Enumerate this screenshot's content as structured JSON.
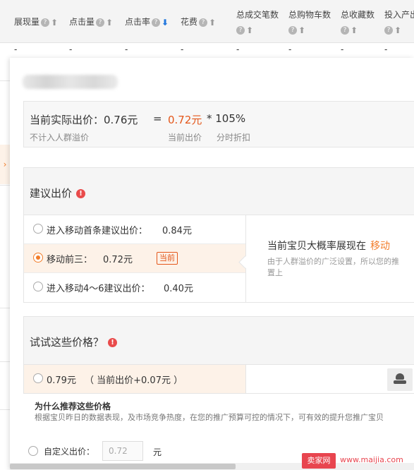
{
  "table_header": {
    "columns": [
      {
        "label": "展现量",
        "sort": "none"
      },
      {
        "label": "点击量",
        "sort": "none"
      },
      {
        "label": "点击率",
        "sort": "desc"
      },
      {
        "label": "花费",
        "sort": "none"
      },
      {
        "label": "总成交笔数",
        "sort": "none"
      },
      {
        "label": "总购物车数",
        "sort": "none"
      },
      {
        "label": "总收藏数",
        "sort": "none"
      },
      {
        "label": "投入产出",
        "sort": "none"
      }
    ],
    "row_dash": "-"
  },
  "bid_summary": {
    "actual_label": "当前实际出价：0.76元",
    "equals": "=",
    "current_bid": "0.72元",
    "multiplier": "* 105%",
    "note_actual": "不计入人群溢价",
    "note_current": "当前出价",
    "note_discount": "分时折扣"
  },
  "suggest": {
    "title": "建议出价",
    "options": [
      {
        "label": "进入移动首条建议出价：",
        "value": "0.84元",
        "selected": false
      },
      {
        "label": "移动前三：",
        "value": "0.72元",
        "selected": true,
        "badge": "当前"
      },
      {
        "label": "进入移动4～6建议出价：",
        "value": "0.40元",
        "selected": false
      }
    ],
    "right_title": "当前宝贝大概率展现在",
    "right_highlight": "移动",
    "right_desc_line1": "由于人群溢价的广泛设置，所以您的推",
    "right_desc_line2": "置上"
  },
  "try_prices": {
    "title": "试试这些价格？",
    "option_price": "0.79元",
    "option_note": "（ 当前出价+0.07元 ）",
    "why_title": "为什么推荐这些价格",
    "why_desc": "根据宝贝昨日的数据表现，及市场竞争热度，在您的推广预算可控的情况下，可有效的提升您推广宝贝"
  },
  "custom_bid": {
    "label": "自定义出价：",
    "value": "0.72",
    "unit": "元"
  },
  "watermark": {
    "logo": "卖家网",
    "url": "www.maijia.com"
  },
  "colors": {
    "accent_orange": "#f27d2a",
    "price_red": "#e4571b",
    "sort_blue": "#2277dd"
  }
}
